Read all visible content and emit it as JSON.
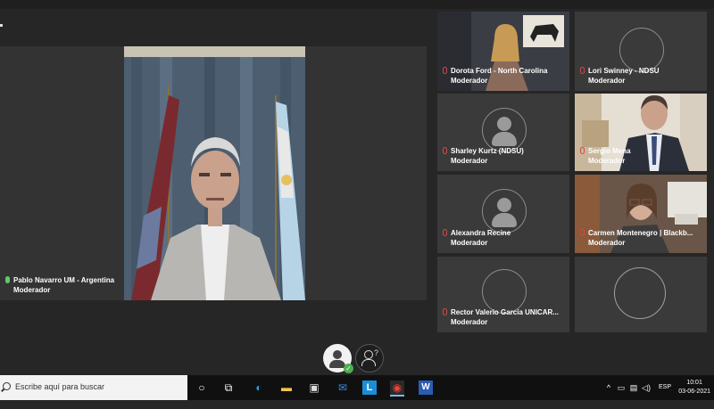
{
  "participants": {
    "main": {
      "name": "Pablo Navarro UM - Argentina",
      "role": "Moderador"
    },
    "dorota": {
      "name": "Dorota Ford - North Carolina",
      "role": "Moderador"
    },
    "lori": {
      "name": "Lori Swinney - NDSU",
      "role": "Moderador"
    },
    "sharley": {
      "name": "Sharley Kurtz (NDSU)",
      "role": "Moderador"
    },
    "sergio": {
      "name": "Sergio Mena",
      "role": "Moderador"
    },
    "alexandra": {
      "name": "Alexandra Recine",
      "role": "Moderador"
    },
    "carmen": {
      "name": "Carmen Montenegro | Blackb...",
      "role": "Moderador"
    },
    "rector": {
      "name": "Rector Valerio García UNICAR...",
      "role": "Moderador"
    }
  },
  "taskbar": {
    "search_placeholder": "Escribe aquí para buscar",
    "language": "ESP",
    "time": "10:01",
    "date": "03-06-2021"
  },
  "colors": {
    "muted_mic": "#d24a43",
    "active_mic": "#5fc86a",
    "taskbar": "#101010"
  }
}
